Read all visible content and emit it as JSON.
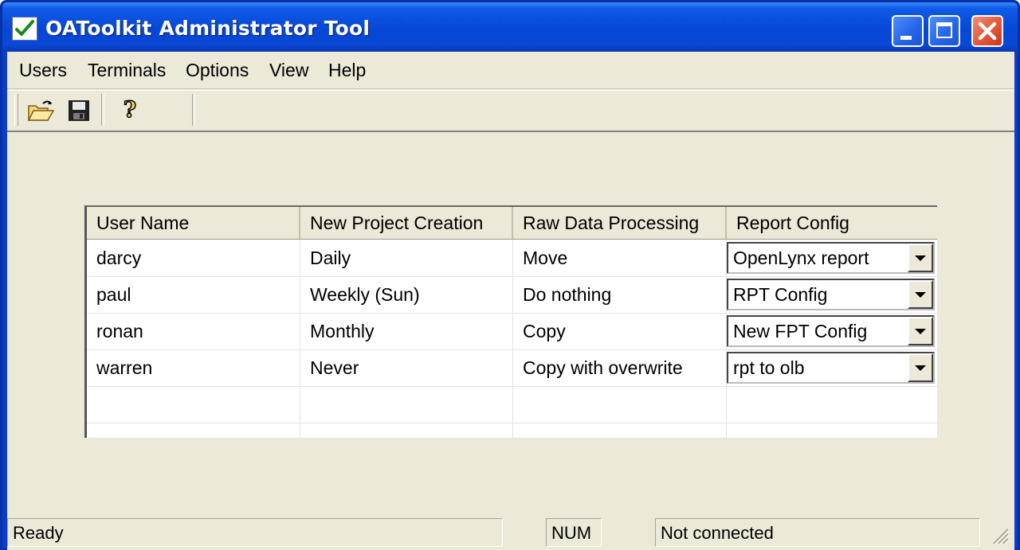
{
  "window": {
    "title": "OAToolkit Administrator Tool"
  },
  "menu": [
    {
      "label": "Users"
    },
    {
      "label": "Terminals"
    },
    {
      "label": "Options"
    },
    {
      "label": "View"
    },
    {
      "label": "Help"
    }
  ],
  "toolbar": {
    "icons": [
      "open-folder-icon",
      "save-disk-icon",
      "help-icon"
    ]
  },
  "table": {
    "headers": [
      "User Name",
      "New Project Creation",
      "Raw Data Processing",
      "Report Config"
    ],
    "rows": [
      {
        "user": "darcy",
        "creation": "Daily",
        "processing": "Move",
        "report": "OpenLynx report"
      },
      {
        "user": "paul",
        "creation": "Weekly (Sun)",
        "processing": "Do nothing",
        "report": "RPT Config"
      },
      {
        "user": "ronan",
        "creation": "Monthly",
        "processing": "Copy",
        "report": "New FPT Config"
      },
      {
        "user": "warren",
        "creation": "Never",
        "processing": "Copy with overwrite",
        "report": "rpt to olb"
      }
    ]
  },
  "status": {
    "state": "Ready",
    "num": "NUM",
    "connection": "Not connected"
  },
  "colors": {
    "titlebar": "#0a48d6",
    "close_button": "#e2573b",
    "dialog_face": "#ece9d8"
  }
}
